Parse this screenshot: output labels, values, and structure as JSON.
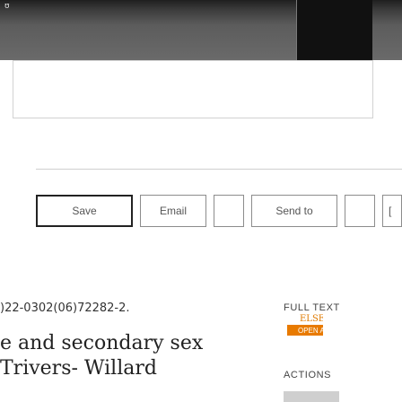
{
  "toolbar": {
    "buttons": [
      {
        "label": "Save"
      },
      {
        "label": "Email"
      },
      {
        "label": "Send to"
      },
      {
        "label": "["
      }
    ]
  },
  "record": {
    "id_text": ")22-0302(06)72282-2.",
    "title_line1": "e and secondary sex",
    "title_line2": "Trivers- Willard"
  },
  "side": {
    "full_text_label": "FULL TEXT",
    "logo_text": "ELSE",
    "logo_subtext": "OPEN A",
    "actions_label": "ACTIONS"
  }
}
